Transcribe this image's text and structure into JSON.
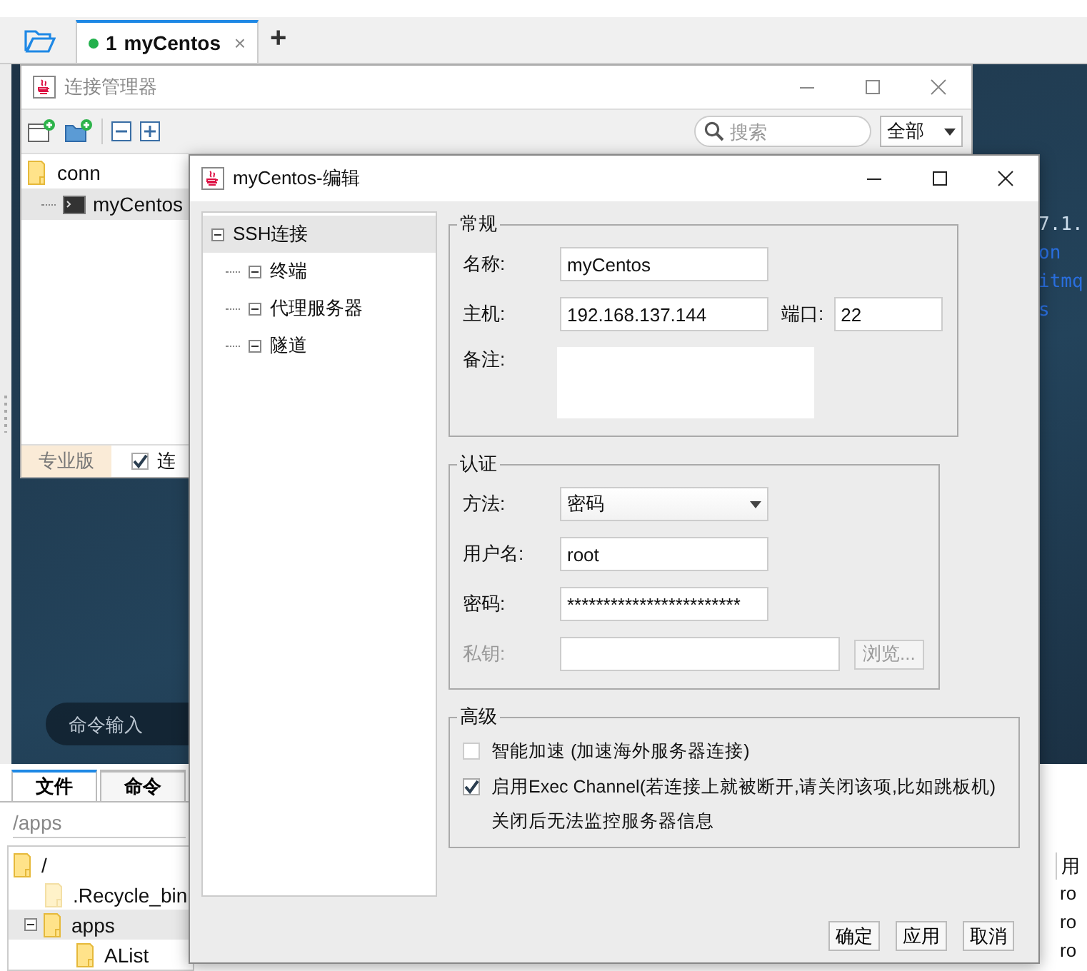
{
  "session_tabs": {
    "tabs": [
      {
        "number": "1",
        "label": "myCentos",
        "connected": true,
        "selected": true,
        "close": "×"
      }
    ],
    "add": "+"
  },
  "terminal": {
    "lines": [
      "7.1.",
      "on",
      "itmq",
      "s"
    ],
    "command_input": {
      "placeholder": "命令输入"
    }
  },
  "bottom_panel": {
    "tabs": [
      {
        "label": "文件",
        "selected": true
      },
      {
        "label": "命令",
        "selected": false
      }
    ],
    "path": "/apps",
    "tree": [
      {
        "name": "/",
        "hidden": false,
        "selected": false,
        "children": [
          {
            "name": ".Recycle_bin",
            "hidden": true,
            "selected": false
          },
          {
            "name": "apps",
            "hidden": false,
            "expanded": true,
            "selected": true,
            "children": [
              {
                "name": "AList",
                "hidden": false,
                "selected": false
              }
            ]
          }
        ]
      }
    ],
    "table": {
      "columns": [
        "用"
      ],
      "rows": [
        [
          "ro"
        ],
        [
          "ro"
        ],
        [
          "ro"
        ]
      ]
    }
  },
  "connection_manager": {
    "title": "连接管理器",
    "search": {
      "placeholder": "搜索"
    },
    "filter": "全部",
    "tree": [
      {
        "name": "conn",
        "kind": "folder",
        "selected": false,
        "children": [
          {
            "name": "myCentos",
            "kind": "session",
            "selected": true
          }
        ]
      }
    ],
    "edition": "专业版",
    "connect_option": {
      "label": "连",
      "checked": true
    }
  },
  "edit_dialog": {
    "title": "myCentos-编辑",
    "tree": [
      {
        "label": "SSH连接",
        "expanded": true,
        "selected": true,
        "children": [
          {
            "label": "终端",
            "expanded": true,
            "selected": false
          },
          {
            "label": "代理服务器",
            "expanded": true,
            "selected": false
          },
          {
            "label": "隧道",
            "expanded": true,
            "selected": false
          }
        ]
      }
    ],
    "general": {
      "title": "常规",
      "name": {
        "label": "名称:",
        "value": "myCentos"
      },
      "host": {
        "label": "主机:",
        "value": "192.168.137.144"
      },
      "port": {
        "label": "端口:",
        "value": "22"
      },
      "note": {
        "label": "备注:"
      }
    },
    "auth": {
      "title": "认证",
      "method": {
        "label": "方法:",
        "value": "密码"
      },
      "user": {
        "label": "用户名:",
        "value": "root"
      },
      "password": {
        "label": "密码:",
        "value": "************************"
      },
      "key": {
        "label": "私钥:",
        "disabled": true,
        "browse": "浏览..."
      }
    },
    "advanced": {
      "title": "高级",
      "options": [
        {
          "label": "智能加速 (加速海外服务器连接)",
          "checked": false
        },
        {
          "label": "启用Exec Channel(若连接上就被断开,请关闭该项,比如跳板机)",
          "checked": true
        }
      ],
      "note": "关闭后无法监控服务器信息"
    },
    "buttons": [
      "确定",
      "应用",
      "取消"
    ]
  }
}
